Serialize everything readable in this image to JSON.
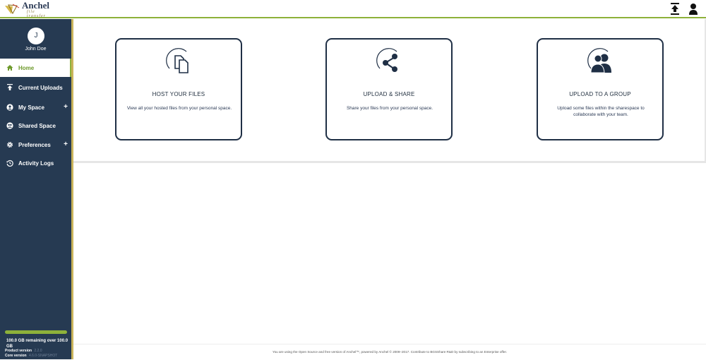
{
  "header": {
    "brand": "Anchel",
    "brand_sub": "file transfer",
    "upload_icon": "upload-icon",
    "user_icon": "user-icon"
  },
  "sidebar": {
    "avatar_initial": "J",
    "user_name": "John Doe",
    "items": [
      {
        "label": "Home",
        "icon": "home-icon",
        "active": true,
        "expandable": false
      },
      {
        "label": "Current Uploads",
        "icon": "upload-icon",
        "active": false,
        "expandable": false
      },
      {
        "label": "My Space",
        "icon": "user-circle-icon",
        "active": false,
        "expandable": true
      },
      {
        "label": "Shared Space",
        "icon": "group-circle-icon",
        "active": false,
        "expandable": false
      },
      {
        "label": "Preferences",
        "icon": "gear-icon",
        "active": false,
        "expandable": true
      },
      {
        "label": "Activity Logs",
        "icon": "history-icon",
        "active": false,
        "expandable": false
      }
    ],
    "expand_symbol": "+",
    "quota_fraction": 1.0,
    "quota_text": "100.0 GB remaining over 100.0 GB",
    "product_version_label": "Product version",
    "product_version": "2.2.0",
    "core_version_label": "Core version",
    "core_version": "4.6.0-SNAPSHOT"
  },
  "cards": [
    {
      "title": "HOST YOUR FILES",
      "desc": "View all your hosted files from your personal space.",
      "icon": "files-icon"
    },
    {
      "title": "UPLOAD & SHARE",
      "desc": "Share your files from your personal space.",
      "icon": "share-icon"
    },
    {
      "title": "UPLOAD TO A GROUP",
      "desc": "Upload some files within the sharespace to collaborate with your team.",
      "icon": "group-icon"
    }
  ],
  "footer": {
    "text": "You are using the Open Source and free version of Anchel™, powered by Anchel © 2009–2017. Contribute to BGSShare R&D by subscribing to an Enterprise offer."
  },
  "colors": {
    "sidebar_bg": "#263a52",
    "accent_green": "#8db13a",
    "card_border": "#1f2f45"
  }
}
